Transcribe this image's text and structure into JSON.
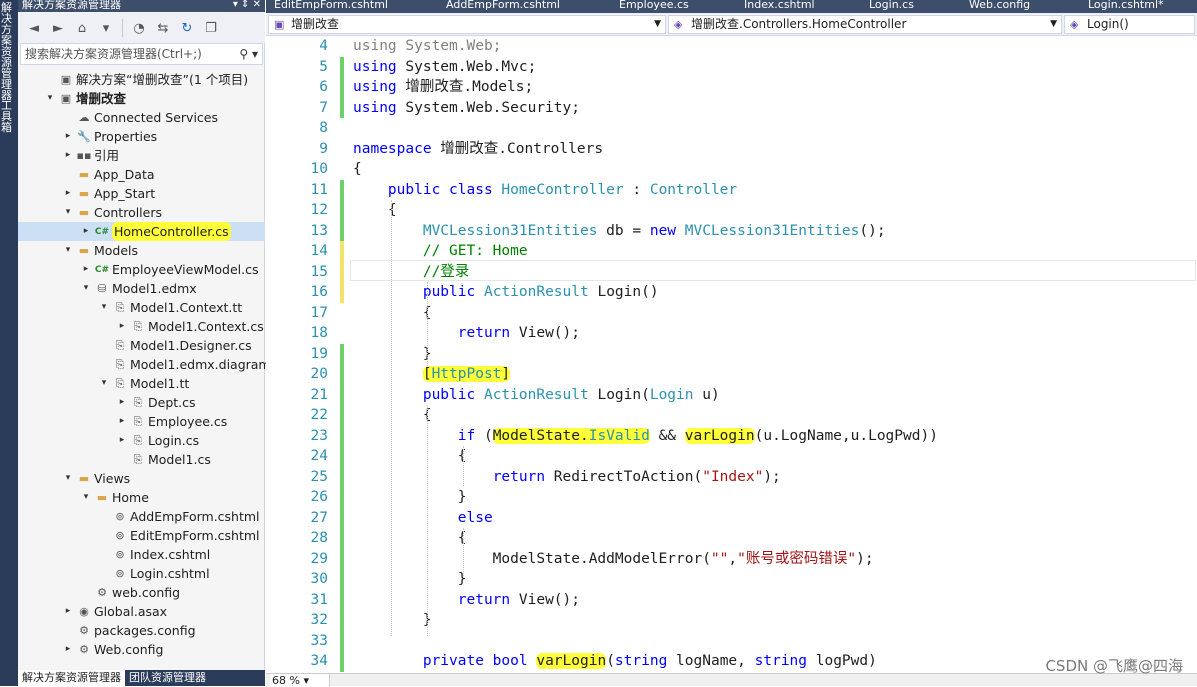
{
  "left_strip": {
    "label1": "解决方案资源管理器",
    "label2": "工具箱"
  },
  "solution_explorer": {
    "title": "解决方案资源管理器",
    "title_controls": "▾ ⇕ ✕",
    "search_placeholder": "搜索解决方案资源管理器(Ctrl+;)",
    "tree": [
      {
        "label": "解决方案“增删改查”(1 个项目)",
        "icon": "solution-icon",
        "arrow": "",
        "depth": 0
      },
      {
        "label": "增删改查",
        "icon": "csharp-project-icon",
        "arrow": "▾",
        "depth": 0,
        "bold": true
      },
      {
        "label": "Connected Services",
        "icon": "connected-services-icon",
        "arrow": "",
        "depth": 1
      },
      {
        "label": "Properties",
        "icon": "wrench-icon",
        "arrow": "▸",
        "depth": 1
      },
      {
        "label": "引用",
        "icon": "references-icon",
        "arrow": "▸",
        "depth": 1
      },
      {
        "label": "App_Data",
        "icon": "folder-icon",
        "arrow": "",
        "depth": 1
      },
      {
        "label": "App_Start",
        "icon": "folder-icon",
        "arrow": "▸",
        "depth": 1
      },
      {
        "label": "Controllers",
        "icon": "folder-open-icon",
        "arrow": "▾",
        "depth": 1
      },
      {
        "label": "HomeController.cs",
        "icon": "csharp-file-icon",
        "arrow": "▸",
        "depth": 2,
        "selected": true,
        "highlight": true
      },
      {
        "label": "Models",
        "icon": "folder-open-icon",
        "arrow": "▾",
        "depth": 1
      },
      {
        "label": "EmployeeViewModel.cs",
        "icon": "csharp-file-icon",
        "arrow": "▸",
        "depth": 2
      },
      {
        "label": "Model1.edmx",
        "icon": "edmx-icon",
        "arrow": "▾",
        "depth": 2
      },
      {
        "label": "Model1.Context.tt",
        "icon": "tt-file-icon",
        "arrow": "▾",
        "depth": 3
      },
      {
        "label": "Model1.Context.cs",
        "icon": "tt-file-icon",
        "arrow": "▸",
        "depth": 4
      },
      {
        "label": "Model1.Designer.cs",
        "icon": "tt-file-icon",
        "arrow": "",
        "depth": 3
      },
      {
        "label": "Model1.edmx.diagram",
        "icon": "tt-file-icon",
        "arrow": "",
        "depth": 3
      },
      {
        "label": "Model1.tt",
        "icon": "tt-file-icon",
        "arrow": "▾",
        "depth": 3
      },
      {
        "label": "Dept.cs",
        "icon": "tt-file-icon",
        "arrow": "▸",
        "depth": 4
      },
      {
        "label": "Employee.cs",
        "icon": "tt-file-icon",
        "arrow": "▸",
        "depth": 4
      },
      {
        "label": "Login.cs",
        "icon": "tt-file-icon",
        "arrow": "▸",
        "depth": 4
      },
      {
        "label": "Model1.cs",
        "icon": "tt-file-icon",
        "arrow": "",
        "depth": 4
      },
      {
        "label": "Views",
        "icon": "folder-open-icon",
        "arrow": "▾",
        "depth": 1
      },
      {
        "label": "Home",
        "icon": "folder-open-icon",
        "arrow": "▾",
        "depth": 2
      },
      {
        "label": "AddEmpForm.cshtml",
        "icon": "cshtml-file-icon",
        "arrow": "",
        "depth": 3
      },
      {
        "label": "EditEmpForm.cshtml",
        "icon": "cshtml-file-icon",
        "arrow": "",
        "depth": 3
      },
      {
        "label": "Index.cshtml",
        "icon": "cshtml-file-icon",
        "arrow": "",
        "depth": 3
      },
      {
        "label": "Login.cshtml",
        "icon": "cshtml-file-icon",
        "arrow": "",
        "depth": 3
      },
      {
        "label": "web.config",
        "icon": "config-file-icon",
        "arrow": "",
        "depth": 2
      },
      {
        "label": "Global.asax",
        "icon": "global-asax-icon",
        "arrow": "▸",
        "depth": 1
      },
      {
        "label": "packages.config",
        "icon": "config-file-icon",
        "arrow": "",
        "depth": 1
      },
      {
        "label": "Web.config",
        "icon": "config-file-icon",
        "arrow": "▸",
        "depth": 1
      }
    ],
    "bottom_tabs": [
      "解决方案资源管理器",
      "团队资源管理器"
    ]
  },
  "doc_tabs": [
    "EditEmpForm.cshtml",
    "AddEmpForm.cshtml",
    "Employee.cs",
    "Index.cshtml",
    "Login.cs",
    "Web.config",
    "Login.cshtml*"
  ],
  "nav": {
    "project": "增删改查",
    "class": "增删改查.Controllers.HomeController",
    "member": "Login()"
  },
  "code_lines": [
    {
      "n": "4",
      "html": "<span class=\"g\">using System.Web;</span>"
    },
    {
      "n": "5",
      "html": "<span class=\"k\">using</span> System.Web.Mvc;"
    },
    {
      "n": "6",
      "html": "<span class=\"k\">using</span> 增删改查.Models;"
    },
    {
      "n": "7",
      "html": "<span class=\"k\">using</span> System.Web.Security;"
    },
    {
      "n": "8",
      "html": ""
    },
    {
      "n": "9",
      "html": "<span class=\"k\">namespace</span> 增删改查.Controllers"
    },
    {
      "n": "10",
      "html": "{"
    },
    {
      "n": "11",
      "html": "    <span class=\"k\">public class</span> <span class=\"t\">HomeController</span> : <span class=\"t\">Controller</span>"
    },
    {
      "n": "12",
      "html": "    {"
    },
    {
      "n": "13",
      "html": "        <span class=\"t\">MVCLession31Entities</span> db = <span class=\"k\">new</span> <span class=\"t\">MVCLession31Entities</span>();"
    },
    {
      "n": "14",
      "html": "        <span class=\"c\">// GET: Home</span>"
    },
    {
      "n": "15",
      "html": "        <span class=\"c\">//登录</span>"
    },
    {
      "n": "16",
      "html": "        <span class=\"k\">public</span> <span class=\"t\">ActionResult</span> Login()"
    },
    {
      "n": "17",
      "html": "        {"
    },
    {
      "n": "18",
      "html": "            <span class=\"k\">return</span> View();"
    },
    {
      "n": "19",
      "html": "        }"
    },
    {
      "n": "20",
      "html": "        <span class=\"hy\">[<span class=\"t\">HttpPost</span>]</span>"
    },
    {
      "n": "21",
      "html": "        <span class=\"k\">public</span> <span class=\"t\">ActionResult</span> Login(<span class=\"t\">Login</span> u)"
    },
    {
      "n": "22",
      "html": "        {"
    },
    {
      "n": "23",
      "html": "            <span class=\"k\">if</span> (<span class=\"hy\">ModelState.<span class=\"t\">IsValid</span></span> &amp;&amp; <span class=\"hy\">varLogin</span>(u.LogName,u.LogPwd))"
    },
    {
      "n": "24",
      "html": "            {"
    },
    {
      "n": "25",
      "html": "                <span class=\"k\">return</span> RedirectToAction(<span class=\"s\">\"Index\"</span>);"
    },
    {
      "n": "26",
      "html": "            }"
    },
    {
      "n": "27",
      "html": "            <span class=\"k\">else</span>"
    },
    {
      "n": "28",
      "html": "            {"
    },
    {
      "n": "29",
      "html": "                ModelState.AddModelError(<span class=\"s\">\"\"</span>,<span class=\"s\">\"账号或密码错误\"</span>);"
    },
    {
      "n": "30",
      "html": "            }"
    },
    {
      "n": "31",
      "html": "            <span class=\"k\">return</span> View();"
    },
    {
      "n": "32",
      "html": "        }"
    },
    {
      "n": "33",
      "html": ""
    },
    {
      "n": "34",
      "html": "        <span class=\"k\">private bool</span> <span class=\"hy\">varLogin</span>(<span class=\"k\">string</span> logName, <span class=\"k\">string</span> logPwd)"
    }
  ],
  "status": {
    "zoom": "68 %"
  },
  "watermark": "CSDN @飞鹰@四海",
  "colors": {
    "highlight": "#ffff3a",
    "change_bar": "#6cd36c",
    "keyword": "#0000ff",
    "type": "#2b91af",
    "string": "#a31515",
    "comment": "#008000"
  }
}
